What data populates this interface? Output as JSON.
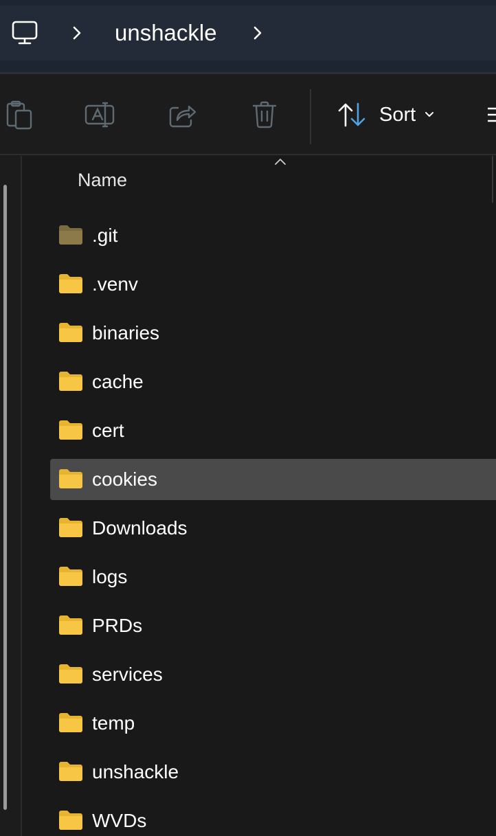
{
  "breadcrumb": {
    "root_icon": "this-pc-icon",
    "current_folder": "unshackle"
  },
  "command_bar": {
    "paste_icon": "paste-icon",
    "rename_icon": "rename-icon",
    "share_icon": "share-icon",
    "delete_icon": "delete-icon",
    "sort_label": "Sort",
    "more_icon": "more-options-icon"
  },
  "columns": {
    "name": "Name"
  },
  "files": [
    {
      "name": ".git",
      "type": "folder",
      "hidden": true
    },
    {
      "name": ".venv",
      "type": "folder"
    },
    {
      "name": "binaries",
      "type": "folder"
    },
    {
      "name": "cache",
      "type": "folder"
    },
    {
      "name": "cert",
      "type": "folder"
    },
    {
      "name": "cookies",
      "type": "folder",
      "selected": true
    },
    {
      "name": "Downloads",
      "type": "folder"
    },
    {
      "name": "logs",
      "type": "folder"
    },
    {
      "name": "PRDs",
      "type": "folder"
    },
    {
      "name": "services",
      "type": "folder"
    },
    {
      "name": "temp",
      "type": "folder"
    },
    {
      "name": "unshackle",
      "type": "folder"
    },
    {
      "name": "WVDs",
      "type": "folder"
    }
  ],
  "colors": {
    "folder": "#f7c644",
    "folder_hidden": "#8c7a4a",
    "sort_accent": "#4ea4e4"
  }
}
